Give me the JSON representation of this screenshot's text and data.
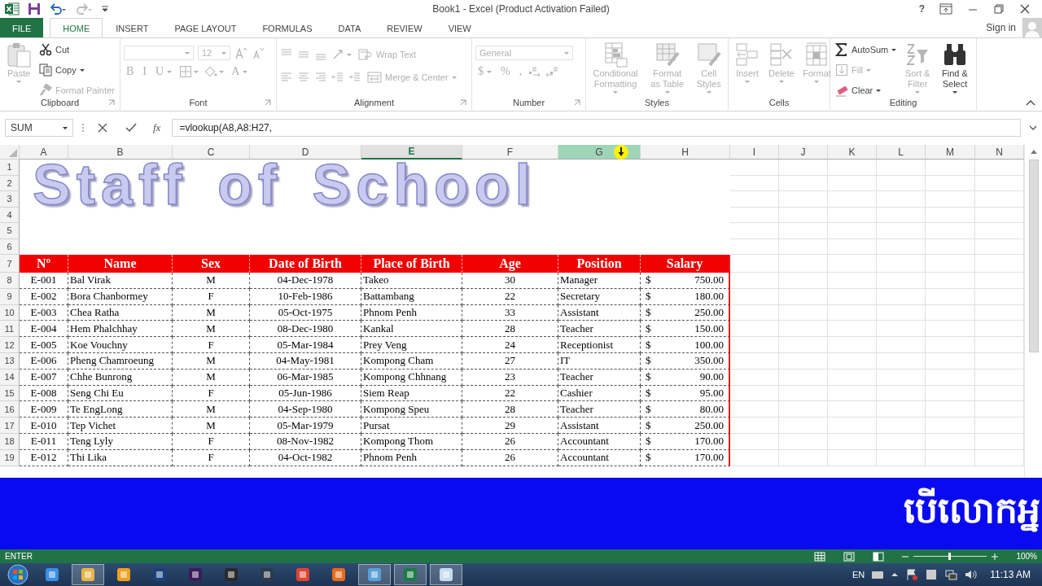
{
  "window": {
    "title": "Book1 - Excel (Product Activation Failed)",
    "help": "?"
  },
  "ribbon_tabs": [
    {
      "label": "FILE",
      "kind": "file",
      "selected": false
    },
    {
      "label": "HOME",
      "kind": "tab",
      "selected": true
    },
    {
      "label": "INSERT",
      "kind": "tab",
      "selected": false
    },
    {
      "label": "PAGE LAYOUT",
      "kind": "tab",
      "selected": false
    },
    {
      "label": "FORMULAS",
      "kind": "tab",
      "selected": false
    },
    {
      "label": "DATA",
      "kind": "tab",
      "selected": false
    },
    {
      "label": "REVIEW",
      "kind": "tab",
      "selected": false
    },
    {
      "label": "VIEW",
      "kind": "tab",
      "selected": false
    }
  ],
  "account": {
    "label": "Sign in"
  },
  "ribbon_groups": [
    {
      "label": "Clipboard",
      "items": [
        {
          "kind": "large",
          "label": "Paste",
          "disabled": true,
          "dropdown": true
        },
        {
          "kind": "small",
          "label": "Cut",
          "disabled": false,
          "dropdown": false
        },
        {
          "kind": "small",
          "label": "Copy",
          "disabled": false,
          "dropdown": true
        },
        {
          "kind": "small",
          "label": "Format Painter",
          "disabled": true,
          "dropdown": false
        }
      ]
    },
    {
      "label": "Font",
      "rows": [
        [
          {
            "kind": "field",
            "disabled": true,
            "dropdown": true
          },
          {
            "kind": "field",
            "value": "12",
            "disabled": true,
            "dropdown": true
          },
          {
            "kind": "icon",
            "disabled": true,
            "dropdown": false
          },
          {
            "kind": "icon",
            "disabled": true,
            "dropdown": false
          }
        ],
        [
          {
            "kind": "glyph",
            "label": "B",
            "disabled": true,
            "dropdown": false
          },
          {
            "kind": "glyph",
            "label": "I",
            "disabled": true,
            "dropdown": false
          },
          {
            "kind": "glyph",
            "label": "U",
            "disabled": true,
            "dropdown": true
          },
          {
            "kind": "icon",
            "disabled": true,
            "dropdown": true
          },
          {
            "kind": "icon",
            "disabled": true,
            "dropdown": true
          },
          {
            "kind": "glyph",
            "label": "A",
            "disabled": true,
            "dropdown": true
          }
        ]
      ]
    },
    {
      "label": "Alignment",
      "rows": [
        [
          {
            "kind": "icon",
            "disabled": true,
            "dropdown": false
          },
          {
            "kind": "icon",
            "disabled": true,
            "dropdown": false
          },
          {
            "kind": "icon",
            "disabled": true,
            "dropdown": false
          },
          {
            "kind": "icon",
            "disabled": true,
            "dropdown": true
          },
          {
            "kind": "small",
            "label": "Wrap Text",
            "disabled": true,
            "dropdown": false
          }
        ],
        [
          {
            "kind": "icon",
            "disabled": true,
            "dropdown": false
          },
          {
            "kind": "icon",
            "disabled": true,
            "dropdown": false
          },
          {
            "kind": "icon",
            "disabled": true,
            "dropdown": false
          },
          {
            "kind": "icon",
            "disabled": true,
            "dropdown": false
          },
          {
            "kind": "icon",
            "disabled": true,
            "dropdown": false
          },
          {
            "kind": "small",
            "label": "Merge & Center",
            "disabled": true,
            "dropdown": true
          }
        ]
      ]
    },
    {
      "label": "Number",
      "rows": [
        [
          {
            "kind": "field",
            "value": "General",
            "disabled": true,
            "dropdown": true
          }
        ],
        [
          {
            "kind": "glyph",
            "label": "$",
            "disabled": true,
            "dropdown": true
          },
          {
            "kind": "glyph",
            "label": "%",
            "disabled": true,
            "dropdown": false
          },
          {
            "kind": "glyph",
            "label": ",",
            "disabled": true,
            "dropdown": false
          },
          {
            "kind": "icon",
            "disabled": true,
            "dropdown": false
          },
          {
            "kind": "icon",
            "disabled": true,
            "dropdown": false
          }
        ]
      ]
    },
    {
      "label": "Styles",
      "items": [
        {
          "kind": "large",
          "label": "Conditional Formatting",
          "disabled": true,
          "dropdown": true
        },
        {
          "kind": "large",
          "label": "Format as Table",
          "disabled": true,
          "dropdown": true
        },
        {
          "kind": "large",
          "label": "Cell Styles",
          "disabled": true,
          "dropdown": true
        }
      ]
    },
    {
      "label": "Cells",
      "items": [
        {
          "kind": "large",
          "label": "Insert",
          "disabled": true,
          "dropdown": true
        },
        {
          "kind": "large",
          "label": "Delete",
          "disabled": true,
          "dropdown": true
        },
        {
          "kind": "large",
          "label": "Format",
          "disabled": true,
          "dropdown": true
        }
      ]
    },
    {
      "label": "Editing",
      "items": [
        {
          "kind": "small",
          "label": "AutoSum",
          "disabled": false,
          "dropdown": true
        },
        {
          "kind": "small",
          "label": "Fill",
          "disabled": true,
          "dropdown": true
        },
        {
          "kind": "small",
          "label": "Clear",
          "disabled": false,
          "dropdown": true
        },
        {
          "kind": "large",
          "label": "Sort & Filter",
          "disabled": true,
          "dropdown": true
        },
        {
          "kind": "large",
          "label": "Find & Select",
          "disabled": false,
          "dropdown": true
        }
      ]
    }
  ],
  "formula_bar": {
    "name_box": "SUM",
    "function_button": "fx",
    "formula": "=vlookup(A8,A8:H27,"
  },
  "sheet": {
    "columns": [
      {
        "label": "A",
        "selected": false,
        "highlighted": false
      },
      {
        "label": "B",
        "selected": false,
        "highlighted": false
      },
      {
        "label": "C",
        "selected": false,
        "highlighted": false
      },
      {
        "label": "D",
        "selected": false,
        "highlighted": false
      },
      {
        "label": "E",
        "selected": true,
        "highlighted": false
      },
      {
        "label": "F",
        "selected": false,
        "highlighted": false
      },
      {
        "label": "G",
        "selected": false,
        "highlighted": true
      },
      {
        "label": "H",
        "selected": false,
        "highlighted": false
      },
      {
        "label": "I",
        "selected": false,
        "highlighted": false
      },
      {
        "label": "J",
        "selected": false,
        "highlighted": false
      },
      {
        "label": "K",
        "selected": false,
        "highlighted": false
      },
      {
        "label": "L",
        "selected": false,
        "highlighted": false
      },
      {
        "label": "M",
        "selected": false,
        "highlighted": false
      },
      {
        "label": "N",
        "selected": false,
        "highlighted": false
      }
    ],
    "rows": [
      "1",
      "2",
      "3",
      "4",
      "5",
      "6",
      "7",
      "8",
      "9",
      "10",
      "11",
      "12",
      "13",
      "14",
      "15",
      "16",
      "17",
      "18",
      "19"
    ],
    "title_art": "Staff of School",
    "table": {
      "header": [
        "Nº",
        "Name",
        "Sex",
        "Date of Birth",
        "Place of Birth",
        "Age",
        "Position",
        "Salary"
      ],
      "rows": [
        [
          "E-001",
          "Bal Virak",
          "M",
          "04-Dec-1978",
          "Takeo",
          "30",
          "Manager",
          {
            "currency": "$",
            "amount": "750.00"
          }
        ],
        [
          "E-002",
          "Bora Chanbormey",
          "F",
          "10-Feb-1986",
          "Battambang",
          "22",
          "Secretary",
          {
            "currency": "$",
            "amount": "180.00"
          }
        ],
        [
          "E-003",
          "Chea Ratha",
          "M",
          "05-Oct-1975",
          "Phnom Penh",
          "33",
          "Assistant",
          {
            "currency": "$",
            "amount": "250.00"
          }
        ],
        [
          "E-004",
          "Hem Phalchhay",
          "M",
          "08-Dec-1980",
          "Kankal",
          "28",
          "Teacher",
          {
            "currency": "$",
            "amount": "150.00"
          }
        ],
        [
          "E-005",
          "Koe Vouchny",
          "F",
          "05-Mar-1984",
          "Prey Veng",
          "24",
          "Receptionist",
          {
            "currency": "$",
            "amount": "100.00"
          }
        ],
        [
          "E-006",
          "Pheng Chamroeung",
          "M",
          "04-May-1981",
          "Kompong Cham",
          "27",
          "IT",
          {
            "currency": "$",
            "amount": "350.00"
          }
        ],
        [
          "E-007",
          "Chhe Bunrong",
          "M",
          "06-Mar-1985",
          "Kompong Chhnang",
          "23",
          "Teacher",
          {
            "currency": "$",
            "amount": "90.00"
          }
        ],
        [
          "E-008",
          "Seng Chi Eu",
          "F",
          "05-Jun-1986",
          "Siem Reap",
          "22",
          "Cashier",
          {
            "currency": "$",
            "amount": "95.00"
          }
        ],
        [
          "E-009",
          "Te EngLong",
          "M",
          "04-Sep-1980",
          "Kompong Speu",
          "28",
          "Teacher",
          {
            "currency": "$",
            "amount": "80.00"
          }
        ],
        [
          "E-010",
          "Tep Vichet",
          "M",
          "05-Mar-1979",
          "Pursat",
          "29",
          "Assistant",
          {
            "currency": "$",
            "amount": "250.00"
          }
        ],
        [
          "E-011",
          "Teng Lyly",
          "F",
          "08-Nov-1982",
          "Kompong Thom",
          "26",
          "Accountant",
          {
            "currency": "$",
            "amount": "170.00"
          }
        ],
        [
          "E-012",
          "Thi Lika",
          "F",
          "04-Oct-1982",
          "Phnom Penh",
          "26",
          "Accountant",
          {
            "currency": "$",
            "amount": "170.00"
          }
        ]
      ]
    }
  },
  "overlay_banner": {
    "text": "បើលោកអ្ន"
  },
  "status_bar": {
    "mode": "ENTER",
    "zoom": {
      "level": 0.5,
      "reading": "100%"
    }
  },
  "taskbar": {
    "apps": [
      {
        "running": false
      },
      {
        "running": true
      },
      {
        "running": false
      },
      {
        "running": false
      },
      {
        "running": false
      },
      {
        "running": false
      },
      {
        "running": false
      },
      {
        "running": false
      },
      {
        "running": false
      },
      {
        "running": true
      },
      {
        "running": true
      },
      {
        "running": true
      }
    ],
    "language": "EN",
    "clock": "11:13 AM"
  }
}
